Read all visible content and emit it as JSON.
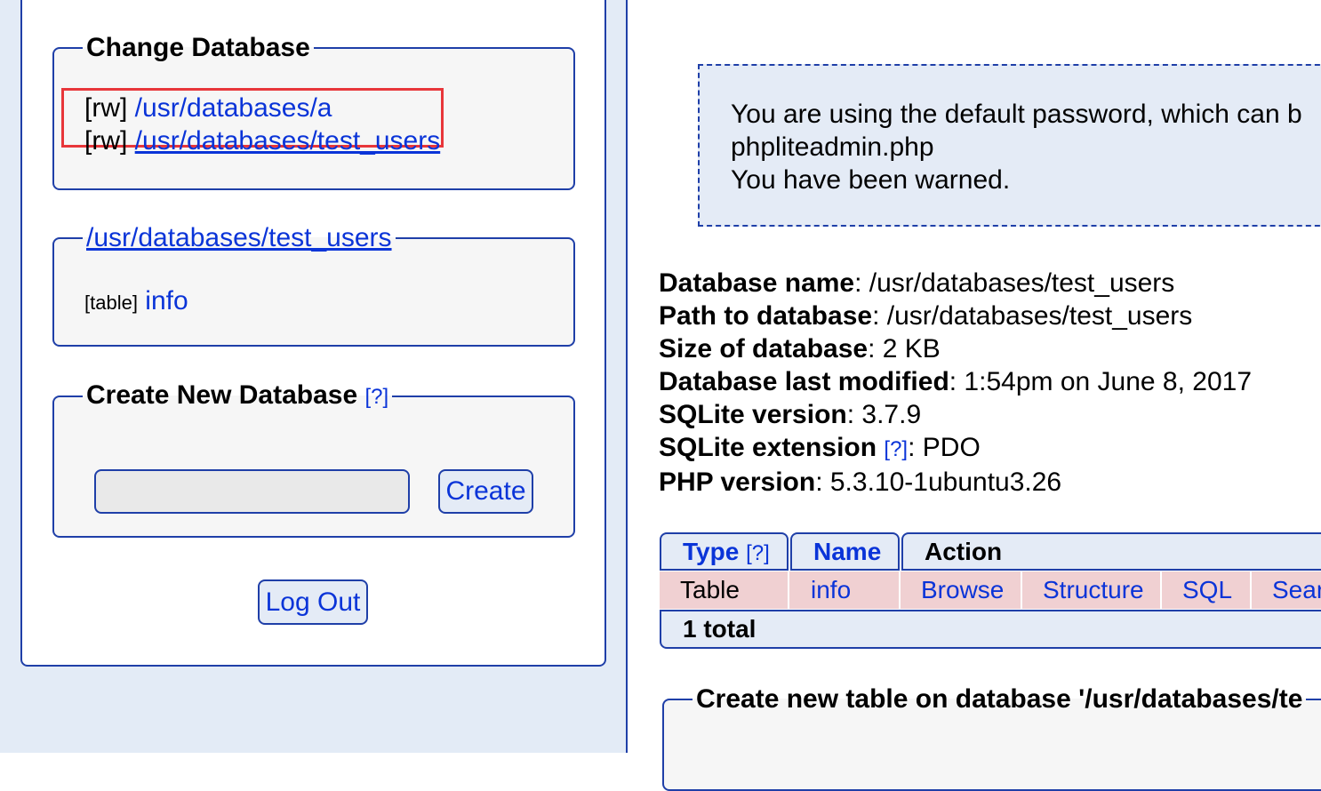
{
  "sidebar": {
    "change_db": {
      "title": "Change Database",
      "items": [
        {
          "mode": "[rw]",
          "path": "/usr/databases/a"
        },
        {
          "mode": "[rw]",
          "path": "/usr/databases/test_users"
        }
      ]
    },
    "current_db": {
      "title": "/usr/databases/test_users",
      "item_type": "[table]",
      "item_name": "info"
    },
    "create_db": {
      "title": "Create New Database",
      "help": "[?]",
      "input_value": "",
      "button_label": "Create"
    },
    "logout_label": "Log Out"
  },
  "warning": {
    "line1": "You are using the default password, which can b",
    "line2": "phpliteadmin.php",
    "line3": "You have been warned."
  },
  "db_info": [
    {
      "label": "Database name",
      "value": ": /usr/databases/test_users"
    },
    {
      "label": "Path to database",
      "value": ": /usr/databases/test_users"
    },
    {
      "label": "Size of database",
      "value": ": 2 KB"
    },
    {
      "label": "Database last modified",
      "value": ": 1:54pm on June 8, 2017"
    },
    {
      "label": "SQLite version",
      "value": ": 3.7.9"
    },
    {
      "label": "SQLite extension",
      "help": "[?]",
      "value": ": PDO"
    },
    {
      "label": "PHP version",
      "value": ": 5.3.10-1ubuntu3.26"
    }
  ],
  "table": {
    "headers": {
      "type": "Type",
      "type_help": "[?]",
      "name": "Name",
      "action": "Action"
    },
    "row": {
      "type": "Table",
      "name": "info",
      "actions": [
        "Browse",
        "Structure",
        "SQL",
        "Sear"
      ]
    },
    "total": "1 total"
  },
  "create_table_title": "Create new table on database '/usr/databases/te",
  "colors": {
    "border": "#1f3fa8",
    "link": "#0a34d8",
    "panel_bg": "#e3ebf6",
    "row_bg": "#f0d0d2",
    "highlight": "#e8363a"
  }
}
